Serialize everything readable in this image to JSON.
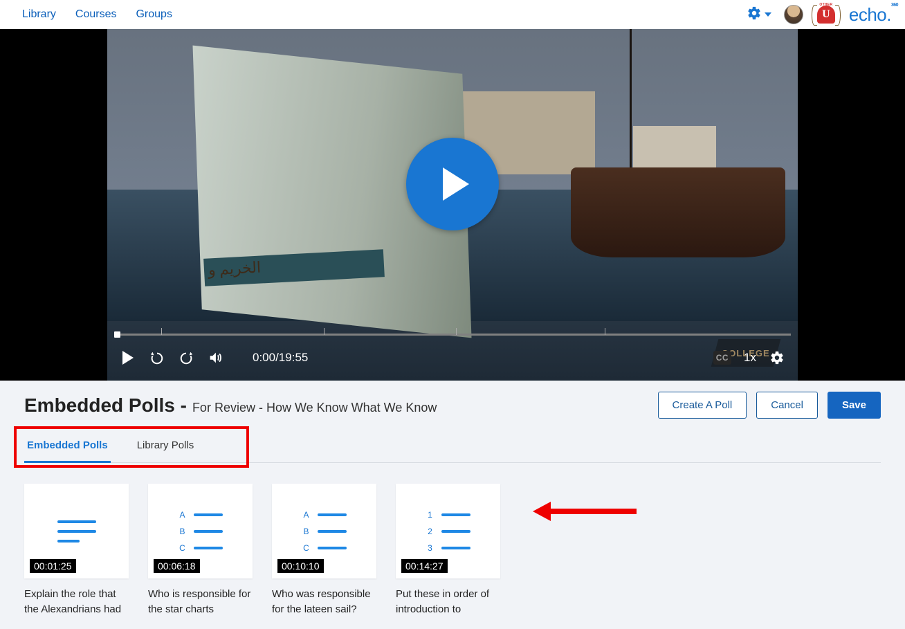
{
  "nav": {
    "library": "Library",
    "courses": "Courses",
    "groups": "Groups"
  },
  "logo": {
    "brand": "echo"
  },
  "crest": {
    "top": "OTHER",
    "letter": "U"
  },
  "player": {
    "time": "0:00/19:55",
    "rate": "1x",
    "cc": "CC",
    "watermark": "COLLEGE"
  },
  "section": {
    "title": "Embedded Polls -",
    "subtitle": "For Review - How We Know What We Know"
  },
  "buttons": {
    "create": "Create A Poll",
    "cancel": "Cancel",
    "save": "Save"
  },
  "tabs": {
    "embedded": "Embedded Polls",
    "library": "Library Polls"
  },
  "polls": [
    {
      "ts": "00:01:25",
      "caption": "Explain the role that the Alexandrians had"
    },
    {
      "ts": "00:06:18",
      "caption": "Who is responsible for the star charts"
    },
    {
      "ts": "00:10:10",
      "caption": "Who was responsible for the lateen sail?"
    },
    {
      "ts": "00:14:27",
      "caption": "Put these in order of introduction to"
    }
  ],
  "icon_labels": {
    "A": "A",
    "B": "B",
    "C": "C",
    "1": "1",
    "2": "2",
    "3": "3"
  }
}
